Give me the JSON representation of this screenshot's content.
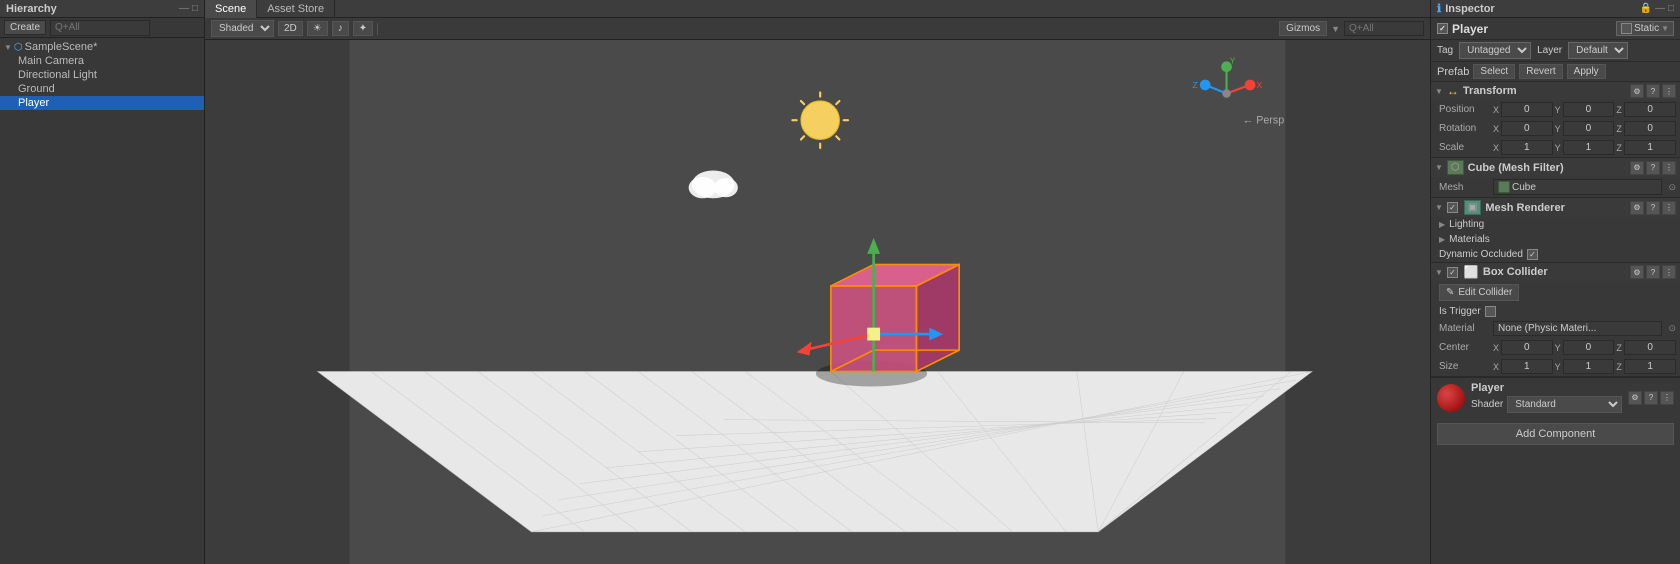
{
  "hierarchy": {
    "title": "Hierarchy",
    "create_label": "Create",
    "search_placeholder": "Q+All",
    "scene_name": "SampleScene*",
    "items": [
      {
        "id": "main-camera",
        "label": "Main Camera",
        "indent": 1,
        "selected": false
      },
      {
        "id": "directional-light",
        "label": "Directional Light",
        "indent": 1,
        "selected": false
      },
      {
        "id": "ground",
        "label": "Ground",
        "indent": 1,
        "selected": false
      },
      {
        "id": "player",
        "label": "Player",
        "indent": 1,
        "selected": true
      }
    ]
  },
  "tabs": {
    "scene": "Scene",
    "asset_store": "Asset Store"
  },
  "scene_toolbar": {
    "shaded_label": "Shaded",
    "twod_label": "2D",
    "gizmos_label": "Gizmos",
    "search_placeholder": "Q+All"
  },
  "inspector": {
    "title": "Inspector",
    "player_name": "Player",
    "static_label": "Static",
    "tag_label": "Tag",
    "tag_value": "Untagged",
    "layer_label": "Layer",
    "layer_value": "Default",
    "prefab_label": "Prefab",
    "select_label": "Select",
    "revert_label": "Revert",
    "apply_label": "Apply",
    "transform": {
      "title": "Transform",
      "position_label": "Position",
      "rotation_label": "Rotation",
      "scale_label": "Scale",
      "pos_x": "0",
      "pos_y": "0",
      "pos_z": "0",
      "rot_x": "0",
      "rot_y": "0",
      "rot_z": "0",
      "scale_x": "1",
      "scale_y": "1",
      "scale_z": "1"
    },
    "mesh_filter": {
      "title": "Cube (Mesh Filter)",
      "mesh_label": "Mesh",
      "mesh_value": "Cube"
    },
    "mesh_renderer": {
      "title": "Mesh Renderer",
      "lighting_label": "Lighting",
      "materials_label": "Materials",
      "dynamic_occluded_label": "Dynamic Occluded"
    },
    "box_collider": {
      "title": "Box Collider",
      "edit_collider_label": "Edit Collider",
      "is_trigger_label": "Is Trigger",
      "material_label": "Material",
      "material_value": "None (Physic Materi...",
      "center_label": "Center",
      "cx": "0",
      "cy": "0",
      "cz": "0",
      "size_label": "Size",
      "sx": "1",
      "sy": "1",
      "sz": "1"
    },
    "player_material": {
      "name": "Player",
      "shader_label": "Shader",
      "shader_value": "Standard"
    },
    "add_component_label": "Add Component"
  }
}
